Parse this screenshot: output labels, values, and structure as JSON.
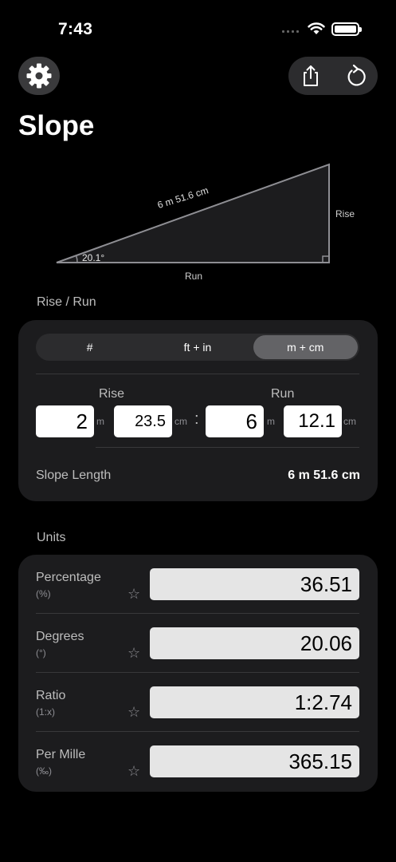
{
  "status": {
    "time": "7:43"
  },
  "header": {
    "title": "Slope"
  },
  "diagram": {
    "angle_label": "20.1°",
    "hypotenuse_label": "6 m 51.6 cm",
    "run_label": "Run",
    "rise_label": "Rise"
  },
  "rise_run": {
    "section_title": "Rise / Run",
    "segments": [
      "#",
      "ft + in",
      "m + cm"
    ],
    "selected_segment": "m + cm",
    "rise_header": "Rise",
    "run_header": "Run",
    "rise_m": "2",
    "rise_cm": "23.5",
    "run_m": "6",
    "run_cm": "12.1",
    "unit_m": "m",
    "unit_cm": "cm",
    "separator": ":",
    "slope_length_label": "Slope Length",
    "slope_length_value": "6 m 51.6 cm"
  },
  "units": {
    "section_title": "Units",
    "rows": [
      {
        "name": "Percentage",
        "symbol": "(%)",
        "value": "36.51"
      },
      {
        "name": "Degrees",
        "symbol": "(°)",
        "value": "20.06"
      },
      {
        "name": "Ratio",
        "symbol": "(1:x)",
        "value": "1:2.74"
      },
      {
        "name": "Per Mille",
        "symbol": "(‰)",
        "value": "365.15"
      }
    ]
  },
  "icons": {
    "settings": "gear-icon",
    "share": "share-icon",
    "reset": "reset-icon",
    "favorite": "star-icon"
  }
}
